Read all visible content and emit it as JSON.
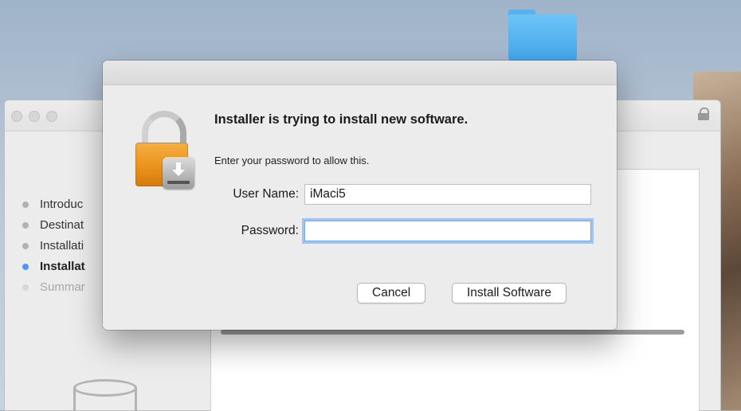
{
  "installer": {
    "steps": [
      {
        "label": "Introduc",
        "state": "done"
      },
      {
        "label": "Destinat",
        "state": "done"
      },
      {
        "label": "Installati",
        "state": "done"
      },
      {
        "label": "Installat",
        "state": "active"
      },
      {
        "label": "Summar",
        "state": "future"
      }
    ]
  },
  "dialog": {
    "heading": "Installer is trying to install new software.",
    "subtext": "Enter your password to allow this.",
    "username_label": "User Name:",
    "username_value": "iMaci5",
    "password_label": "Password:",
    "password_value": "",
    "cancel_label": "Cancel",
    "install_label": "Install Software"
  },
  "colors": {
    "accent": "#4a9af0",
    "lock_orange": "#e8901a",
    "focus_ring": "#9fc4f2",
    "folder_blue": "#46a7ea"
  }
}
